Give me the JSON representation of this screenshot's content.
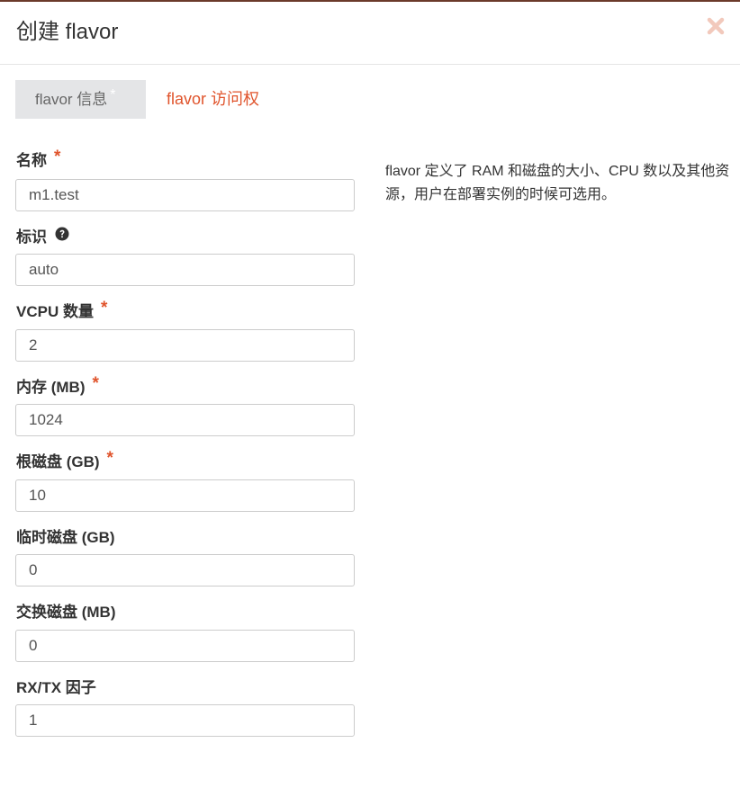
{
  "modal": {
    "title": "创建 flavor",
    "close_icon": "close-icon"
  },
  "tabs": [
    {
      "label": "flavor 信息",
      "required_mark": "*",
      "active": true
    },
    {
      "label": "flavor 访问权",
      "active": false
    }
  ],
  "form": {
    "fields": [
      {
        "label": "名称",
        "required": "*",
        "value": "m1.test"
      },
      {
        "label": "标识",
        "help_icon": "question-circle-icon",
        "value": "auto"
      },
      {
        "label": "VCPU 数量",
        "required": "*",
        "value": "2"
      },
      {
        "label": "内存 (MB)",
        "required": "*",
        "value": "1024"
      },
      {
        "label": "根磁盘 (GB)",
        "required": "*",
        "value": "10"
      },
      {
        "label": "临时磁盘 (GB)",
        "value": "0"
      },
      {
        "label": "交换磁盘 (MB)",
        "value": "0"
      },
      {
        "label": "RX/TX 因子",
        "value": "1"
      }
    ]
  },
  "description": "flavor 定义了 RAM 和磁盘的大小、CPU 数以及其他资源，用户在部署实例的时候可选用。",
  "colors": {
    "accent": "#e0542c",
    "tab_active_bg": "#e4e5e7",
    "close_icon": "#f2c9bc",
    "border": "#cccccc"
  }
}
